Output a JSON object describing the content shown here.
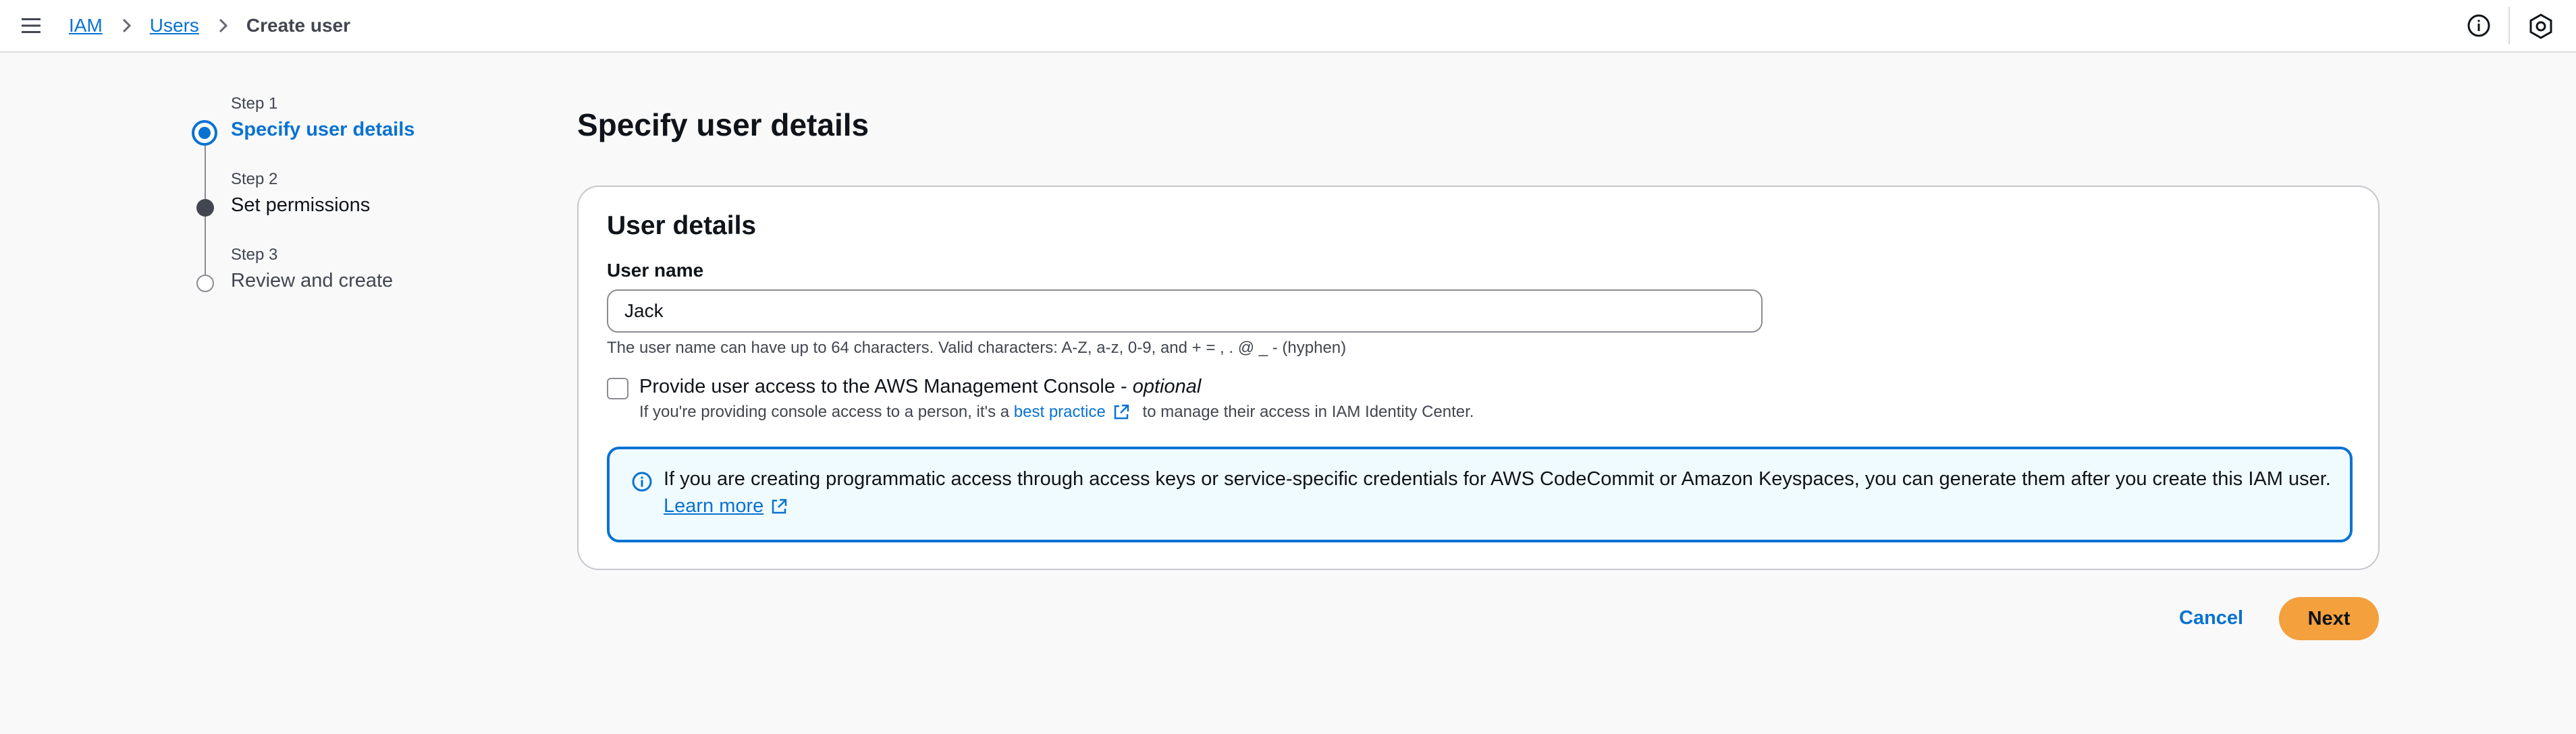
{
  "topbar": {
    "menu_icon": "hamburger-menu-icon",
    "breadcrumbs": [
      {
        "label": "IAM",
        "link": true
      },
      {
        "label": "Users",
        "link": true
      },
      {
        "label": "Create user",
        "link": false
      }
    ],
    "right_icons": [
      "info-icon",
      "settings-icon"
    ]
  },
  "wizard": {
    "steps": [
      {
        "number": "Step 1",
        "title": "Specify user details",
        "state": "current"
      },
      {
        "number": "Step 2",
        "title": "Set permissions",
        "state": "completed"
      },
      {
        "number": "Step 3",
        "title": "Review and create",
        "state": "pending"
      }
    ]
  },
  "main": {
    "page_title": "Specify user details",
    "card_title": "User details",
    "user_name_label": "User name",
    "user_name_value": "Jack",
    "user_name_constraint": "The user name can have up to 64 characters. Valid characters: A-Z, a-z, 0-9, and + = , . @ _ - (hyphen)",
    "console_access": {
      "label": "Provide user access to the AWS Management Console - ",
      "label_optional": "optional",
      "checked": false,
      "desc_before": "If you're providing console access to a person, it's a ",
      "desc_link": "best practice",
      "desc_after": " to manage their access in IAM Identity Center."
    },
    "info_alert": {
      "text": "If you are creating programmatic access through access keys or service-specific credentials for AWS CodeCommit or Amazon Keyspaces, you can generate them after you create this IAM user.",
      "link": "Learn more"
    }
  },
  "actions": {
    "cancel_label": "Cancel",
    "next_label": "Next"
  },
  "colors": {
    "link": "#0972d3",
    "primary_button": "#f3a03d",
    "alert_bg": "#f0fbff",
    "page_bg": "#f9f9f9"
  }
}
